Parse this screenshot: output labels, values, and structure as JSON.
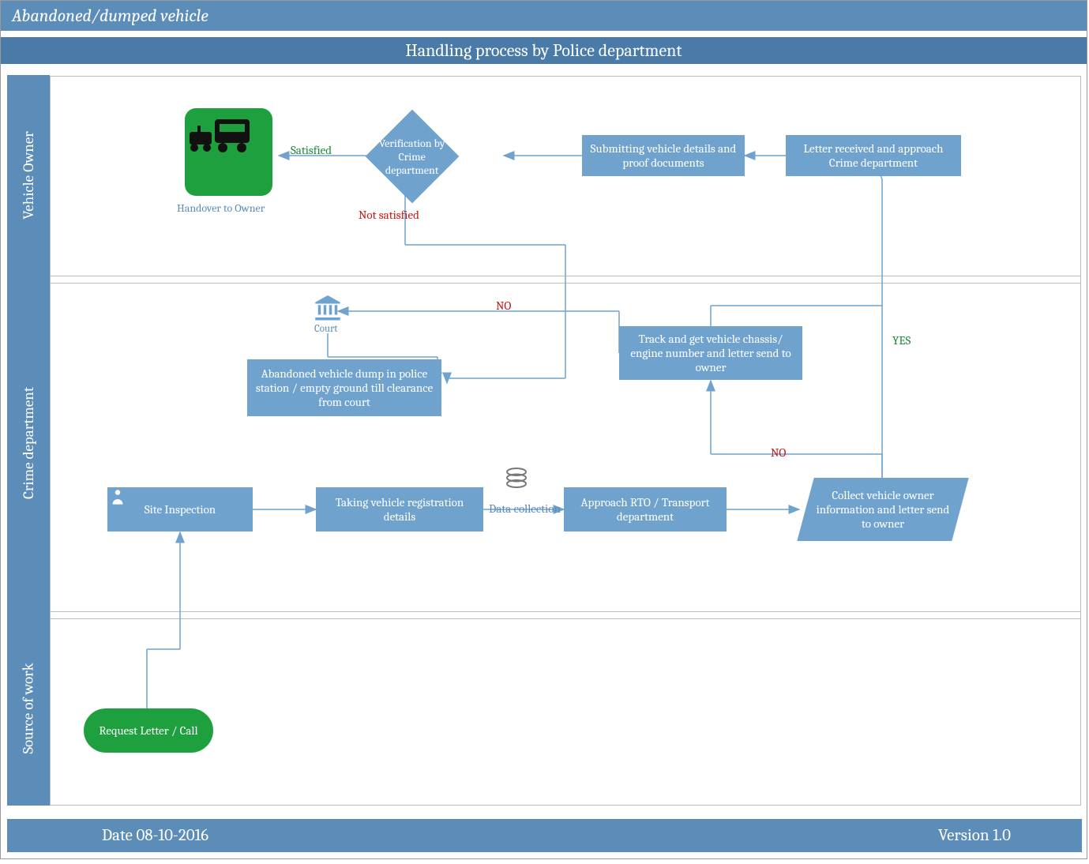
{
  "title": "Abandoned/dumped vehicle",
  "subtitle": "Handling process by Police department",
  "lanes": {
    "owner": "Vehicle Owner",
    "crime": "Crime department",
    "source": "Source of work"
  },
  "nodes": {
    "request": "Request Letter / Call",
    "inspection": "Site Inspection",
    "regdetails": "Taking vehicle registration details",
    "datacoll": "Data collection",
    "rto": "Approach RTO / Transport department",
    "collect": "Collect vehicle owner information and letter send to owner",
    "track": "Track and get vehicle chassis/ engine number and letter send to owner",
    "dump": "Abandoned vehicle dump in police station / empty ground till clearance from court",
    "court": "Court",
    "letter": "Letter received and approach Crime department",
    "submit": "Submitting vehicle details and proof documents",
    "verify": "Verification by Crime department",
    "handover": "Handover to Owner"
  },
  "labels": {
    "yes": "YES",
    "no": "NO",
    "satisfied": "Satisfied",
    "notsatisfied": "Not satisfied"
  },
  "footer": {
    "date": "Date 08-10-2016",
    "version": "Version 1.0"
  }
}
